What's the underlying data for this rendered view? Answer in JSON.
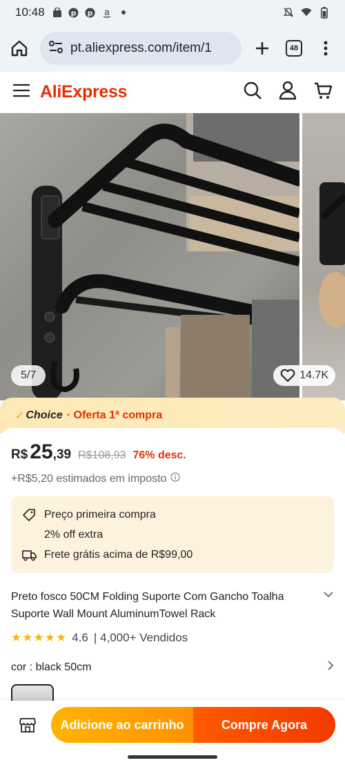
{
  "status_bar": {
    "time": "10:48",
    "notif_icons": [
      "shopping-bag-icon",
      "pinterest-icon",
      "pinterest-icon",
      "amazon-icon",
      "dot-icon"
    ],
    "right_icons": [
      "mute-icon",
      "wifi-icon",
      "battery-icon"
    ]
  },
  "browser": {
    "url": "pt.aliexpress.com/item/1",
    "tab_count": "48"
  },
  "site": {
    "logo": "AliExpress"
  },
  "gallery": {
    "counter": "5/7",
    "wishlist_count": "14.7K"
  },
  "choice_banner": {
    "brand": "Choice",
    "offer": "· Oferta 1ª compra"
  },
  "price": {
    "currency": "R$",
    "integer": "25",
    "decimal": ",39",
    "original": "R$108,93",
    "discount": "76% desc."
  },
  "tax": "+R$5,20 estimados em imposto",
  "promo": {
    "first_purchase": "Preço primeira compra",
    "extra": "2% off extra",
    "shipping": "Frete grátis acima de R$99,00"
  },
  "product": {
    "title": "Preto fosco 50CM Folding Suporte Com Gancho Toalha Suporte Wall Mount AluminumTowel Rack",
    "rating": "4.6",
    "sold": "| 4,000+ Vendidos",
    "color_label": "cor : black 50cm"
  },
  "actions": {
    "add_to_cart": "Adicione ao carrinho",
    "buy_now": "Compre Agora"
  },
  "colors": {
    "brand": "#e62e04",
    "choice_bg": "#fde9b6",
    "promo_bg": "#fdf3dd",
    "cart_btn": "#ffb400",
    "buy_btn": "#ff5a00",
    "star": "#f8b614"
  }
}
